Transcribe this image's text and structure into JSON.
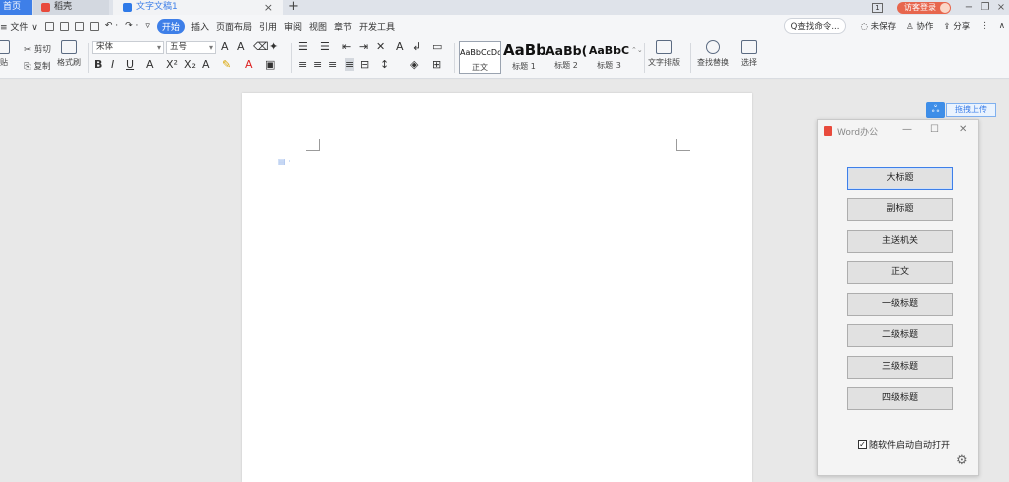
{
  "titlebar": {
    "home_tab": "首页",
    "tabs": [
      "稻壳",
      "文字文稿1"
    ],
    "login": "访客登录"
  },
  "menubar": {
    "file": "≡ 文件 ∨",
    "items": [
      "开始",
      "插入",
      "页面布局",
      "引用",
      "审阅",
      "视图",
      "章节",
      "开发工具"
    ],
    "active": "开始",
    "search": "Q查找命令...",
    "right_items": [
      "未保存",
      "协作",
      "分享"
    ]
  },
  "ribbon": {
    "paste": "贴",
    "cut": "剪切",
    "copy": "复制",
    "brush": "格式刷",
    "font": "宋体",
    "size": "五号",
    "styles": [
      {
        "preview": "AaBbCcDd",
        "name": "正文"
      },
      {
        "preview": "AaBb",
        "name": "标题 1"
      },
      {
        "preview": "AaBb(",
        "name": "标题 2"
      },
      {
        "preview": "AaBbC",
        "name": "标题 3"
      }
    ],
    "text_layout": "文字排版",
    "find_replace": "查找替换",
    "select": "选择"
  },
  "cloud": {
    "label": "拖拽上传"
  },
  "panel": {
    "title": "Word办公",
    "buttons": [
      "大标题",
      "副标题",
      "主送机关",
      "正文",
      "一级标题",
      "二级标题",
      "三级标题",
      "四级标题"
    ],
    "checkbox_label": "随软件启动自动打开",
    "checkbox_checked": true
  }
}
